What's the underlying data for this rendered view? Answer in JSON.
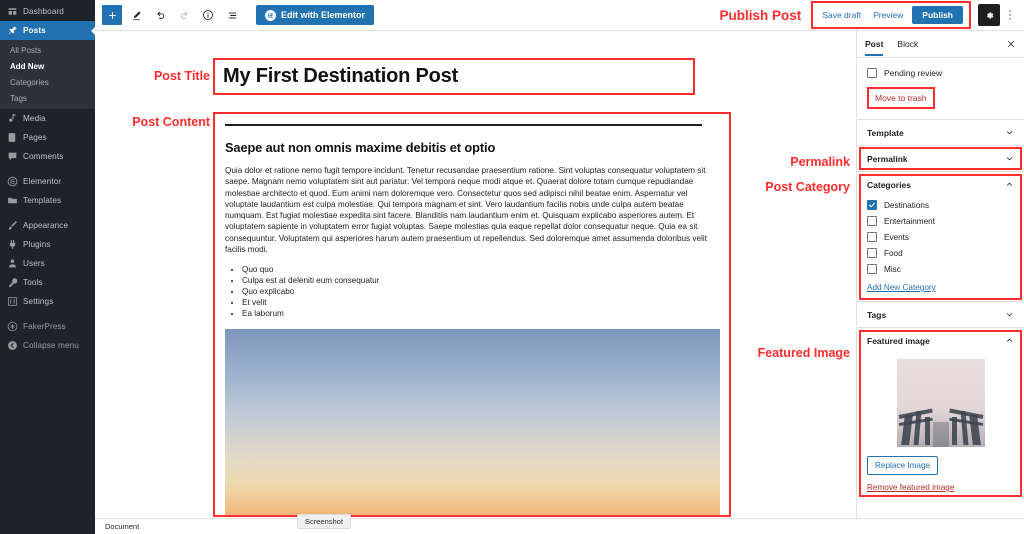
{
  "admin_menu": {
    "items": [
      {
        "label": "Dashboard",
        "icon": "dashboard-icon",
        "current": false
      },
      {
        "label": "Posts",
        "icon": "pin-icon",
        "current": true
      },
      {
        "label": "Media",
        "icon": "media-icon",
        "current": false
      },
      {
        "label": "Pages",
        "icon": "page-icon",
        "current": false
      },
      {
        "label": "Comments",
        "icon": "comment-icon",
        "current": false
      },
      {
        "label": "Elementor",
        "icon": "elementor-icon",
        "current": false
      },
      {
        "label": "Templates",
        "icon": "folder-icon",
        "current": false
      },
      {
        "label": "Appearance",
        "icon": "brush-icon",
        "current": false
      },
      {
        "label": "Plugins",
        "icon": "plug-icon",
        "current": false
      },
      {
        "label": "Users",
        "icon": "user-icon",
        "current": false
      },
      {
        "label": "Tools",
        "icon": "wrench-icon",
        "current": false
      },
      {
        "label": "Settings",
        "icon": "sliders-icon",
        "current": false
      },
      {
        "label": "FakerPress",
        "icon": "fakerpress-icon",
        "current": false
      },
      {
        "label": "Collapse menu",
        "icon": "collapse-icon",
        "current": false
      }
    ],
    "posts_submenu": [
      {
        "label": "All Posts",
        "active": false
      },
      {
        "label": "Add New",
        "active": true
      },
      {
        "label": "Categories",
        "active": false
      },
      {
        "label": "Tags",
        "active": false
      }
    ]
  },
  "toolbar": {
    "add_block_label": "+",
    "tools_icon": "pencil-icon",
    "undo_icon": "undo-icon",
    "redo_icon": "redo-icon",
    "details_icon": "info-icon",
    "list_view_icon": "list-view-icon",
    "elementor_button": "Edit with Elementor",
    "elementor_badge": "e",
    "save_draft": "Save draft",
    "preview": "Preview",
    "publish": "Publish",
    "settings_icon": "gear-icon",
    "more_icon": "more-vertical-icon"
  },
  "annotations": {
    "publish_post": "Publish Post",
    "post_title": "Post Title",
    "post_content": "Post Content",
    "permalink": "Permalink",
    "post_category": "Post Category",
    "featured_image": "Featured Image"
  },
  "post": {
    "title": "My First Destination Post",
    "heading": "Saepe aut non omnis maxime debitis et optio",
    "paragraph_1": "Quia dolor et ratione nemo fugit tempore incidunt. Tenetur recusandae praesentium ratione. Sint voluptas consequatur voluptatem sit saepe. Magnam nemo voluptatem sint aut pariatur. Vel tempora neque modi atque et. Quaerat dolore totam cumque repudiandae molestiae architecto et quod. Eum animi nam doloremque vero. Consectetur quos sed adipisci nihil beatae enim. Aspernatur vel voluptate laudantium est culpa molestiae. Qui tempora magnam et sint. Vero laudantium facilis nobis unde culpa autem beatae numquam. Est fugiat molestiae expedita sint facere. Blanditiis nam laudantium enim et. Quisquam explicabo asperiores autem. Et voluptatem sapiente in voluptatem error fugiat voluptas. Saepe molestias quia eaque repellat dolor consequatur neque. Quia ea sit consequuntur. Voluptatem qui asperiores harum autem praesentium ut repellendus. Sed doloremque amet assumenda doloribus velit facilis modi.",
    "list_items": [
      "Quo quo",
      "Culpa est at deleniti eum consequatur",
      "Quo explicabo",
      "Et velit",
      "Ea laborum"
    ],
    "image_alt": "sunset-sky-image"
  },
  "sidebar": {
    "tabs": [
      {
        "label": "Post",
        "active": true
      },
      {
        "label": "Block",
        "active": false
      }
    ],
    "close_icon": "close-icon",
    "pending_review": {
      "label": "Pending review",
      "checked": false
    },
    "move_to_trash": "Move to trash",
    "panels": [
      {
        "label": "Template",
        "expanded": false
      },
      {
        "label": "Permalink",
        "expanded": false
      },
      {
        "label": "Categories",
        "expanded": true
      },
      {
        "label": "Tags",
        "expanded": false
      },
      {
        "label": "Featured image",
        "expanded": true
      }
    ],
    "categories": [
      {
        "label": "Destinations",
        "checked": true
      },
      {
        "label": "Entertainment",
        "checked": false
      },
      {
        "label": "Events",
        "checked": false
      },
      {
        "label": "Food",
        "checked": false
      },
      {
        "label": "Misc",
        "checked": false
      }
    ],
    "add_new_category": "Add New Category",
    "featured_image": {
      "replace_label": "Replace Image",
      "remove_label": "Remove featured image",
      "thumb_alt": "foggy-boardwalk-thumbnail"
    }
  },
  "bottom_bar": {
    "document_label": "Document",
    "screenshot_tip": "Screenshot"
  },
  "colors": {
    "accent_blue": "#2271b1",
    "annotation_red": "#ff2d2d",
    "admin_bg": "#1d2327",
    "submenu_bg": "#2c3338",
    "danger_red": "#b32d2e"
  }
}
